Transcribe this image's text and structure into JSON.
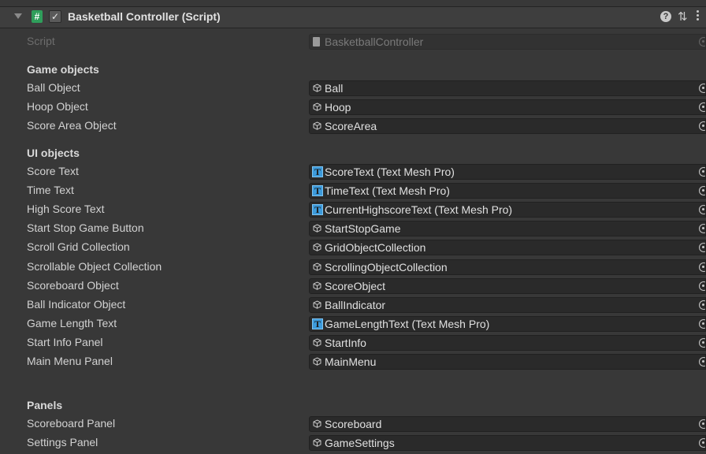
{
  "component": {
    "title": "Basketball Controller (Script)",
    "badge": "#",
    "enabled": "✓"
  },
  "script_row": {
    "label": "Script",
    "value": "BasketballController"
  },
  "sections": [
    {
      "title": "Game objects",
      "rows": [
        {
          "label": "Ball Object",
          "value": "Ball",
          "type": "gameobject"
        },
        {
          "label": "Hoop Object",
          "value": "Hoop",
          "type": "gameobject"
        },
        {
          "label": "Score Area Object",
          "value": "ScoreArea",
          "type": "gameobject"
        }
      ]
    },
    {
      "title": "UI objects",
      "rows": [
        {
          "label": "Score Text",
          "value": "ScoreText (Text Mesh Pro)",
          "type": "tmp"
        },
        {
          "label": "Time Text",
          "value": "TimeText (Text Mesh Pro)",
          "type": "tmp"
        },
        {
          "label": "High Score Text",
          "value": "CurrentHighscoreText (Text Mesh Pro)",
          "type": "tmp"
        },
        {
          "label": "Start Stop Game Button",
          "value": "StartStopGame",
          "type": "gameobject"
        },
        {
          "label": "Scroll Grid Collection",
          "value": "GridObjectCollection",
          "type": "gameobject"
        },
        {
          "label": "Scrollable Object Collection",
          "value": "ScrollingObjectCollection",
          "type": "gameobject"
        },
        {
          "label": "Scoreboard Object",
          "value": "ScoreObject",
          "type": "gameobject"
        },
        {
          "label": "Ball Indicator Object",
          "value": "BallIndicator",
          "type": "gameobject"
        },
        {
          "label": "Game Length Text",
          "value": "GameLengthText (Text Mesh Pro)",
          "type": "tmp"
        },
        {
          "label": "Start Info Panel",
          "value": "StartInfo",
          "type": "gameobject"
        },
        {
          "label": "Main Menu Panel",
          "value": "MainMenu",
          "type": "gameobject"
        }
      ]
    },
    {
      "title": "Panels",
      "rows": [
        {
          "label": "Scoreboard Panel",
          "value": "Scoreboard",
          "type": "gameobject"
        },
        {
          "label": "Settings Panel",
          "value": "GameSettings",
          "type": "gameobject"
        }
      ]
    }
  ],
  "icons": {
    "foldout": "chevron-down-icon",
    "help": "help-icon",
    "preset": "preset-icon",
    "menu": "context-menu-icon",
    "tmp_glyph": "T"
  },
  "colors": {
    "background": "#383838",
    "field": "#2a2a2a",
    "tmp_icon": "#3d9bdc",
    "script_badge": "#2f9e5b"
  }
}
